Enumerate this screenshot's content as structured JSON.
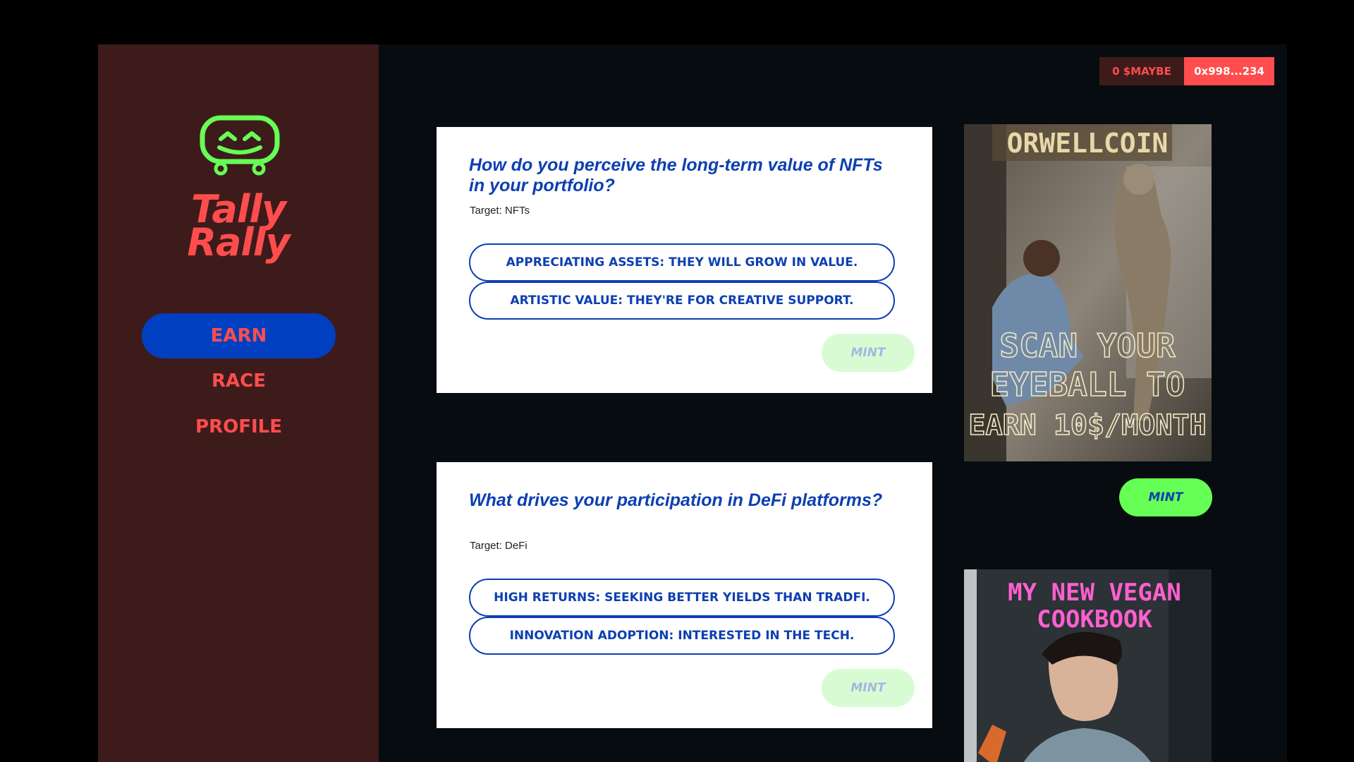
{
  "app": {
    "name": "Tally Rally",
    "name_line1": "Tally",
    "name_line2": "Rally"
  },
  "nav": {
    "items": [
      {
        "label": "EARN",
        "active": true
      },
      {
        "label": "RACE",
        "active": false
      },
      {
        "label": "PROFILE",
        "active": false
      }
    ]
  },
  "wallet": {
    "balance": "0 $MAYBE",
    "address": "0x998...234"
  },
  "questions": [
    {
      "title": "How do you perceive the long-term value of NFTs in your portfolio?",
      "target": "Target: NFTs",
      "answers": [
        "APPRECIATING ASSETS: THEY WILL GROW IN VALUE.",
        "ARTISTIC VALUE: THEY'RE FOR CREATIVE SUPPORT."
      ],
      "mint_label": "MINT"
    },
    {
      "title": "What drives your participation in DeFi platforms?",
      "target": "Target: DeFi",
      "answers": [
        "HIGH RETURNS: SEEKING BETTER YIELDS THAN TRADFI.",
        "INNOVATION ADOPTION: INTERESTED IN THE TECH."
      ],
      "mint_label": "MINT"
    }
  ],
  "nfts": [
    {
      "top_text": "ORWELLCOIN",
      "caption_lines": [
        "SCAN YOUR",
        "EYEBALL TO",
        "EARN 10$/MONTH"
      ],
      "mint_label": "MINT"
    },
    {
      "caption_lines": [
        "MY NEW VEGAN",
        "COOKBOOK"
      ]
    }
  ],
  "colors": {
    "accent_red": "#ff4d4d",
    "sidebar_bg": "#3d1b1b",
    "active_blue": "#0040c0",
    "question_blue": "#0d3fb2",
    "mint_green": "#66ff55",
    "mint_disabled": "#d8fbd4",
    "logo_green": "#66ff55"
  }
}
